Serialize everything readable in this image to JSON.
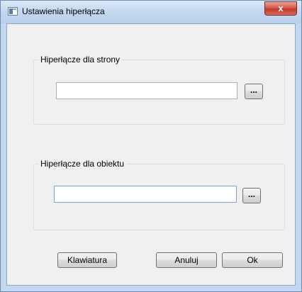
{
  "window": {
    "title": "Ustawienia hiperłącza",
    "close_glyph": "x"
  },
  "group_page": {
    "label": "Hiperłącze dla strony",
    "input_value": "",
    "browse_label": "..."
  },
  "group_object": {
    "label": "Hiperłącze dla obiektu",
    "input_value": "",
    "browse_label": "..."
  },
  "buttons": {
    "keyboard": "Klawiatura",
    "cancel": "Anuluj",
    "ok": "Ok"
  }
}
